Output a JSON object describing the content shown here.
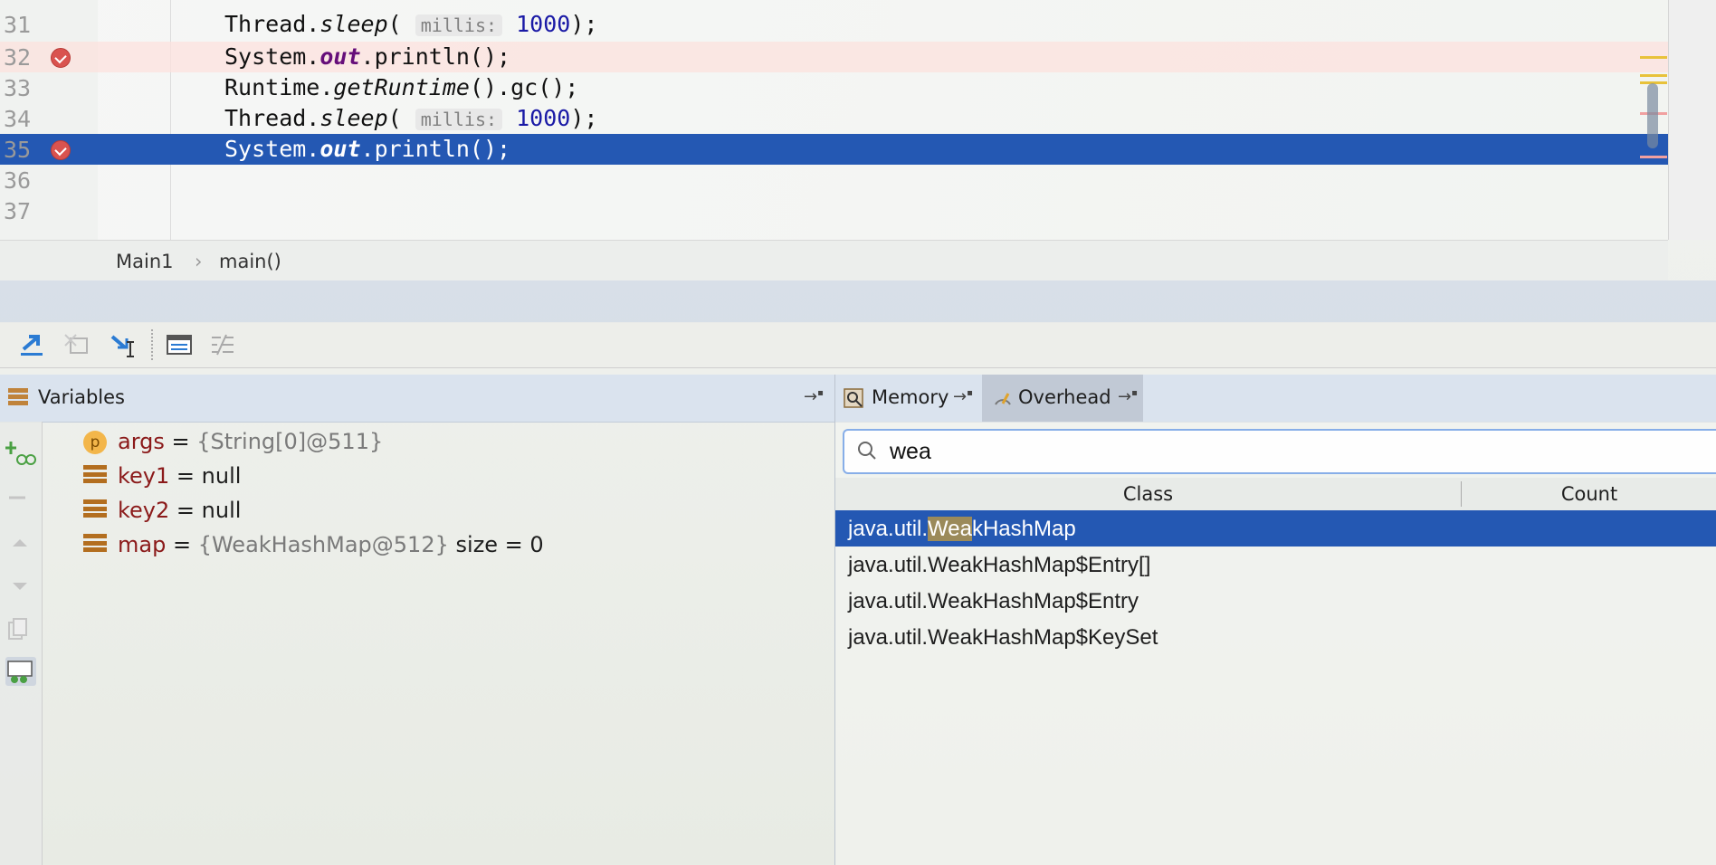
{
  "editor": {
    "lines": [
      {
        "num": "31",
        "prefix": "Thread.",
        "method": "sleep",
        "open": "( ",
        "hint": "millis:",
        "arg": "1000",
        "close": ");"
      },
      {
        "num": "32",
        "prefix": "System.",
        "field": "out",
        "rest": ".println();",
        "breakpoint": true
      },
      {
        "num": "33",
        "prefix": "Runtime.",
        "method": "getRuntime",
        "rest": "().gc();"
      },
      {
        "num": "34",
        "prefix": "Thread.",
        "method": "sleep",
        "open": "( ",
        "hint": "millis:",
        "arg": "1000",
        "close": ");"
      },
      {
        "num": "35",
        "prefix": "System.",
        "field": "out",
        "rest": ".println();",
        "breakpoint": true,
        "current": true
      },
      {
        "num": "36"
      },
      {
        "num": "37"
      }
    ]
  },
  "breadcrumbs": {
    "class_name": "Main1",
    "separator": "›",
    "method_name": "main()"
  },
  "variables": {
    "title": "Variables",
    "items": [
      {
        "icon": "parameter-icon",
        "badge": "p",
        "name": "args",
        "eq": " = ",
        "value": "{String[0]@511}",
        "extra": ""
      },
      {
        "icon": "field-icon",
        "name": "key1",
        "eq": " = ",
        "value": "null",
        "extra": ""
      },
      {
        "icon": "field-icon",
        "name": "key2",
        "eq": " = ",
        "value": "null",
        "extra": ""
      },
      {
        "icon": "field-icon",
        "name": "map",
        "eq": " = ",
        "value": "{WeakHashMap@512}",
        "extra": "size = 0"
      }
    ]
  },
  "tabs": {
    "memory": "Memory",
    "overhead": "Overhead",
    "pin_glyph": "→"
  },
  "memory": {
    "search_value": "wea",
    "columns": {
      "class": "Class",
      "count": "Count"
    },
    "rows": [
      {
        "pre": "java.util.",
        "match": "Wea",
        "post": "kHashMap",
        "selected": true
      },
      {
        "text": "java.util.WeakHashMap$Entry[]"
      },
      {
        "text": "java.util.WeakHashMap$Entry"
      },
      {
        "text": "java.util.WeakHashMap$KeySet"
      }
    ]
  },
  "colors": {
    "selection": "#2458b3",
    "breakpoint": "#d9534f",
    "match_highlight": "#9b8a5a"
  }
}
